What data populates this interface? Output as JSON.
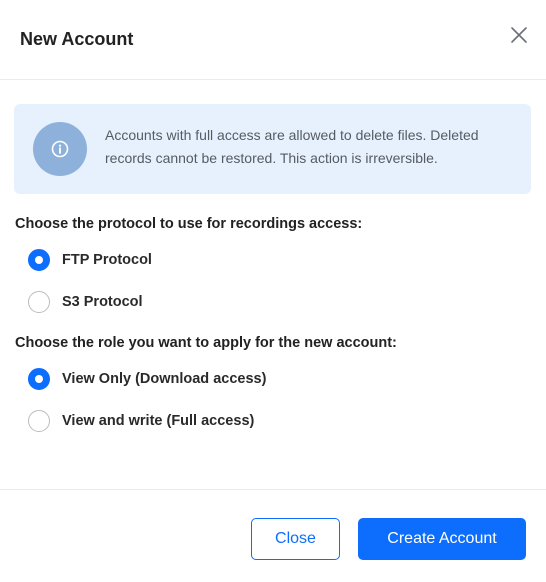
{
  "dialog": {
    "title": "New Account",
    "close_icon": "close-icon"
  },
  "info": {
    "icon": "info-icon",
    "message": "Accounts with full access are allowed to delete files. Deleted records cannot be restored. This action is irreversible."
  },
  "protocol": {
    "label": "Choose the protocol to use for recordings access:",
    "options": [
      {
        "label": "FTP Protocol",
        "selected": true
      },
      {
        "label": "S3 Protocol",
        "selected": false
      }
    ]
  },
  "role": {
    "label": "Choose the role you want to apply for the new account:",
    "options": [
      {
        "label": "View Only (Download access)",
        "selected": true
      },
      {
        "label": "View and write (Full access)",
        "selected": false
      }
    ]
  },
  "footer": {
    "close_label": "Close",
    "create_label": "Create Account"
  },
  "colors": {
    "accent": "#0d6efd",
    "info_background": "#e7f1fd",
    "info_icon_background": "#8eb1dc"
  }
}
